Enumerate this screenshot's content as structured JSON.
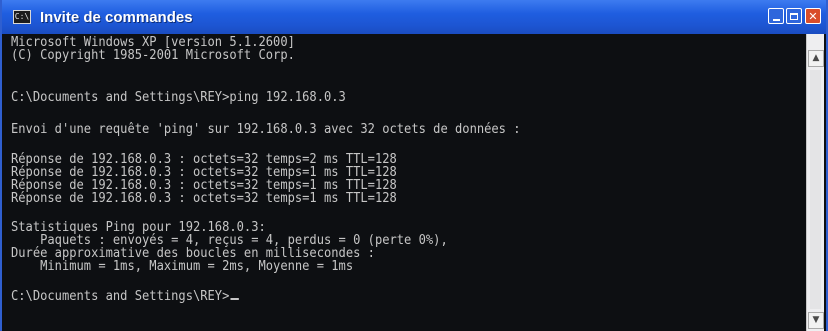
{
  "window": {
    "title": "Invite de commandes",
    "icon": "cmd-icon",
    "icon_glyph": "C:\\"
  },
  "console": {
    "lines": [
      "Microsoft Windows XP [version 5.1.2600]",
      "(C) Copyright 1985-2001 Microsoft Corp.",
      "",
      "C:\\Documents and Settings\\REY>ping 192.168.0.3",
      "",
      "Envoi d'une requête 'ping' sur 192.168.0.3 avec 32 octets de données :",
      "",
      "Réponse de 192.168.0.3 : octets=32 temps=2 ms TTL=128",
      "Réponse de 192.168.0.3 : octets=32 temps=1 ms TTL=128",
      "Réponse de 192.168.0.3 : octets=32 temps=1 ms TTL=128",
      "Réponse de 192.168.0.3 : octets=32 temps=1 ms TTL=128",
      "",
      "Statistiques Ping pour 192.168.0.3:",
      "    Paquets : envoyés = 4, reçus = 4, perdus = 0 (perte 0%),",
      "Durée approximative des boucles en millisecondes :",
      "    Minimum = 1ms, Maximum = 2ms, Moyenne = 1ms",
      "",
      "C:\\Documents and Settings\\REY>"
    ]
  },
  "colors": {
    "titlebar": "#1f5ee0",
    "console_bg": "#0d0f12",
    "console_text": "#c6c6c6",
    "close_button": "#d94d2a"
  }
}
